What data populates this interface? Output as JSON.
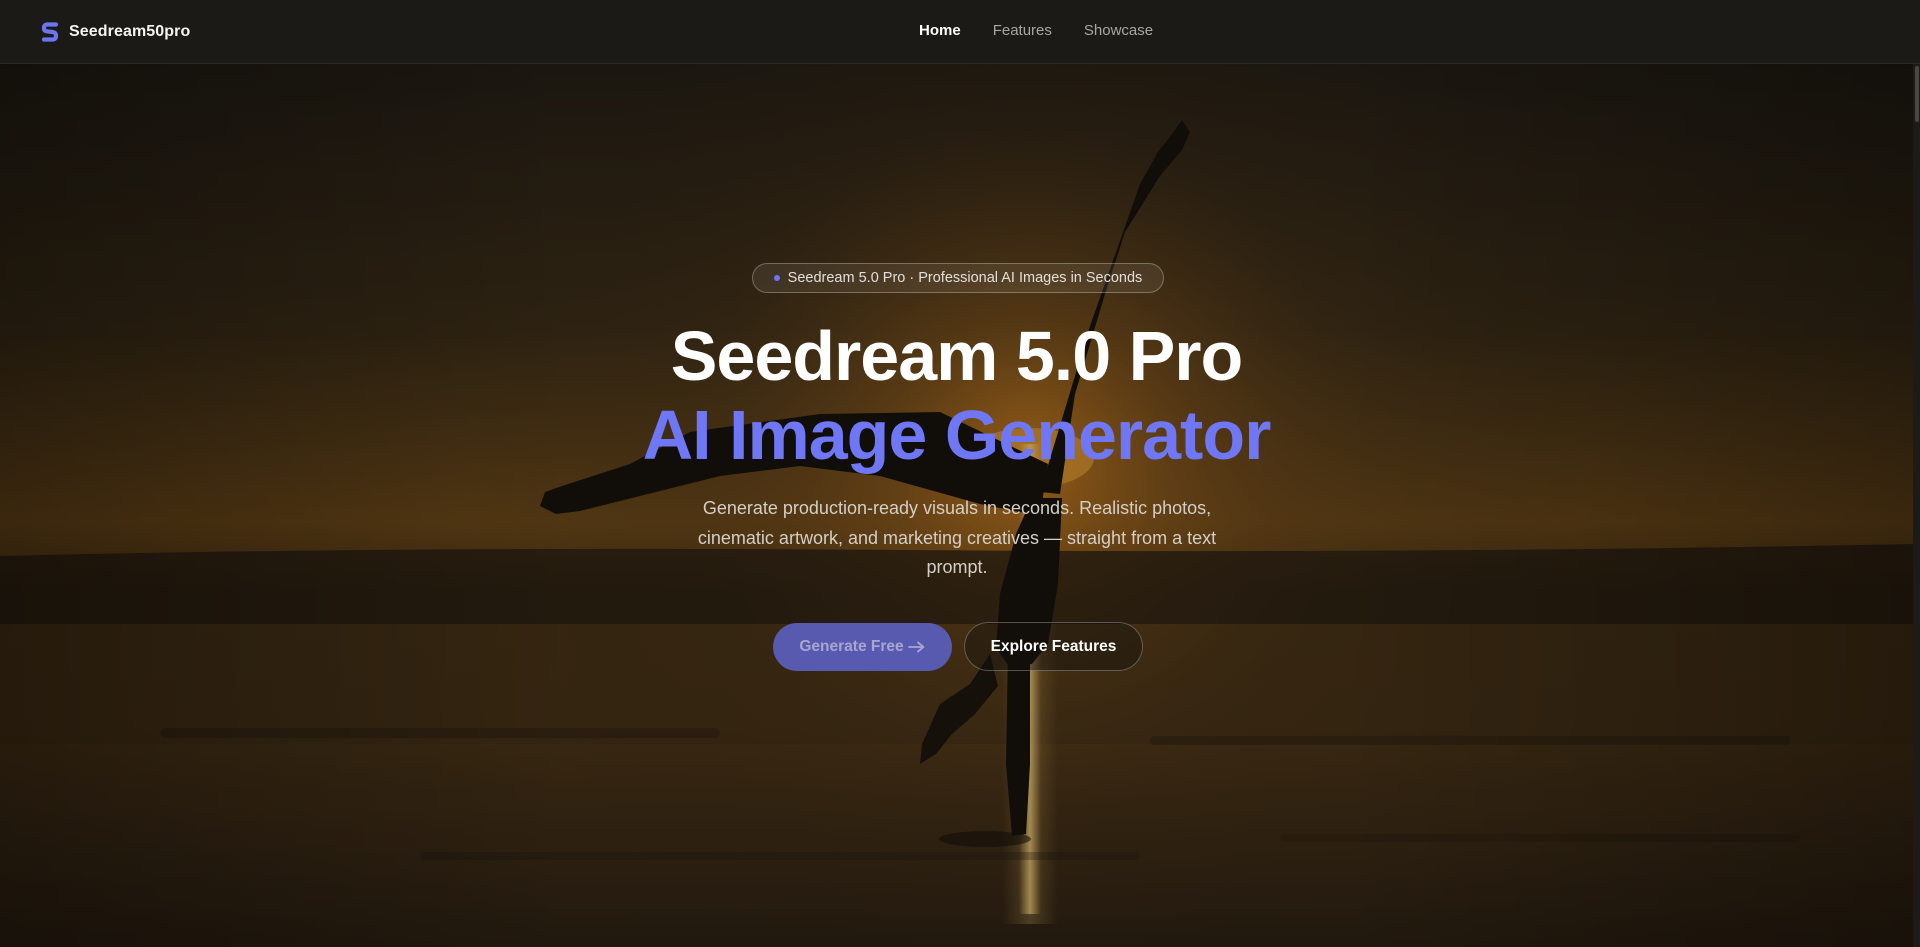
{
  "nav": {
    "brand": {
      "name": "Seedream50pro",
      "logo_icon": "s-logo-icon"
    },
    "links": [
      {
        "label": "Home",
        "active": true
      },
      {
        "label": "Features",
        "active": false
      },
      {
        "label": "Showcase",
        "active": false
      }
    ]
  },
  "hero": {
    "badge": {
      "text": "Seedream 5.0 Pro · Professional AI Images in Seconds"
    },
    "title_line1": "Seedream 5.0 Pro",
    "title_line2": "AI Image Generator",
    "subtitle": "Generate production-ready visuals in seconds. Realistic photos, cinematic artwork, and marketing creatives — straight from a text prompt.",
    "primary_button": {
      "label": "Generate Free",
      "icon": "arrow-right-icon"
    },
    "secondary_button": {
      "label": "Explore Features"
    },
    "background": "silhouette-handstand-beach-sunset"
  },
  "colors": {
    "accent": "#7077f4",
    "primary_button": "#585ab0",
    "nav_bg": "#1b1a17",
    "page_bg": "#1a1712"
  }
}
